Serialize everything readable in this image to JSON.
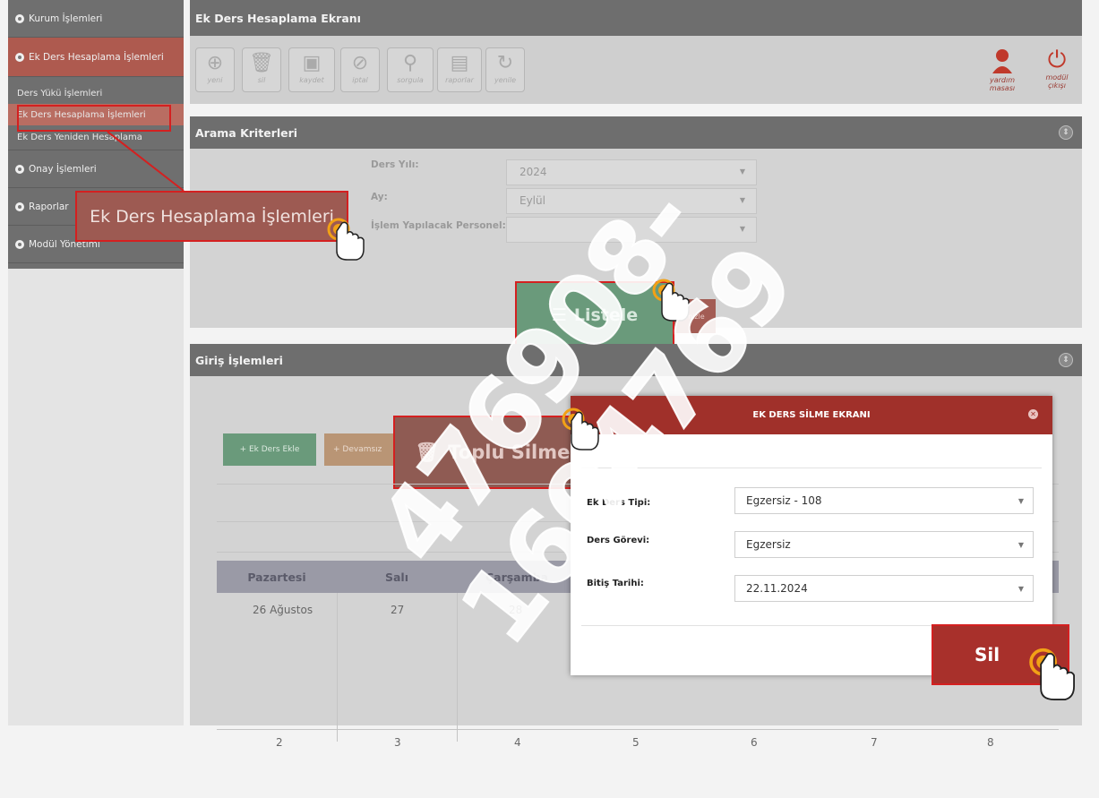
{
  "sidebar": {
    "items": [
      {
        "label": "Kurum İşlemleri"
      },
      {
        "label": "Ek Ders Hesaplama İşlemleri"
      },
      {
        "label": "Ders Yükü İşlemleri"
      },
      {
        "label": "Ek Ders Hesaplama İşlemleri"
      },
      {
        "label": "Ek Ders Yeniden Hesaplama"
      },
      {
        "label": "Onay İşlemleri"
      },
      {
        "label": "Raporlar"
      },
      {
        "label": "Modül Yönetimi"
      }
    ]
  },
  "header": {
    "title": "Ek Ders Hesaplama Ekranı"
  },
  "toolbar": {
    "buttons": [
      "yeni",
      "sil",
      "kaydet",
      "iptal",
      "sorgula",
      "raporlar",
      "yenile"
    ],
    "right": [
      {
        "line1": "yardım",
        "line2": "masası"
      },
      {
        "line1": "modül",
        "line2": "çıkışı"
      }
    ]
  },
  "search": {
    "title": "Arama Kriterleri",
    "ders_yili_label": "Ders Yılı:",
    "ders_yili_value": "2024",
    "ay_label": "Ay:",
    "ay_value": "Eylül",
    "personel_label": "İşlem Yapılacak Personel:",
    "listele_label": "Listele",
    "temizle_label": "mizle"
  },
  "giris": {
    "title": "Giriş İşlemleri",
    "ekle_label": "+ Ek Ders Ekle",
    "devam_label": "+ Devamsız",
    "toplu_label": "Toplu Silme"
  },
  "calendar": {
    "days": [
      "Pazartesi",
      "Salı",
      "Çarşamba",
      "",
      "",
      "",
      ""
    ],
    "row1": [
      "26 Ağustos",
      "27",
      "28"
    ],
    "row2": [
      "2",
      "3",
      "4",
      "5",
      "6",
      "7",
      "8"
    ]
  },
  "modal": {
    "title": "EK DERS SİLME EKRANI",
    "ek_ders_tipi_label": "Ek Ders Tipi:",
    "ek_ders_tipi_value": "Egzersiz - 108",
    "ders_gorevi_label": "Ders Görevi:",
    "ders_gorevi_value": "Egzersiz",
    "bitis_tarihi_label": "Bitiş Tarihi:",
    "bitis_tarihi_value": "22.11.2024",
    "sil_label": "Sil"
  },
  "callout": {
    "label": "Ek Ders Hesaplama İşlemleri"
  },
  "watermark": {
    "text": "476908-1604769"
  },
  "colors": {
    "accent_red": "#a0302a",
    "highlight_border": "#d42020",
    "cursor_ring": "#f2a116"
  }
}
